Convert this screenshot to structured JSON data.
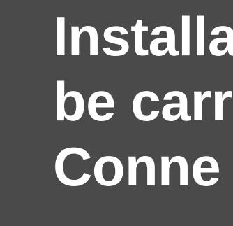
{
  "content": {
    "lines": [
      "Installa",
      "be carr",
      "Conne"
    ]
  },
  "colors": {
    "background": "#4a4a4a",
    "text": "#ffffff"
  }
}
